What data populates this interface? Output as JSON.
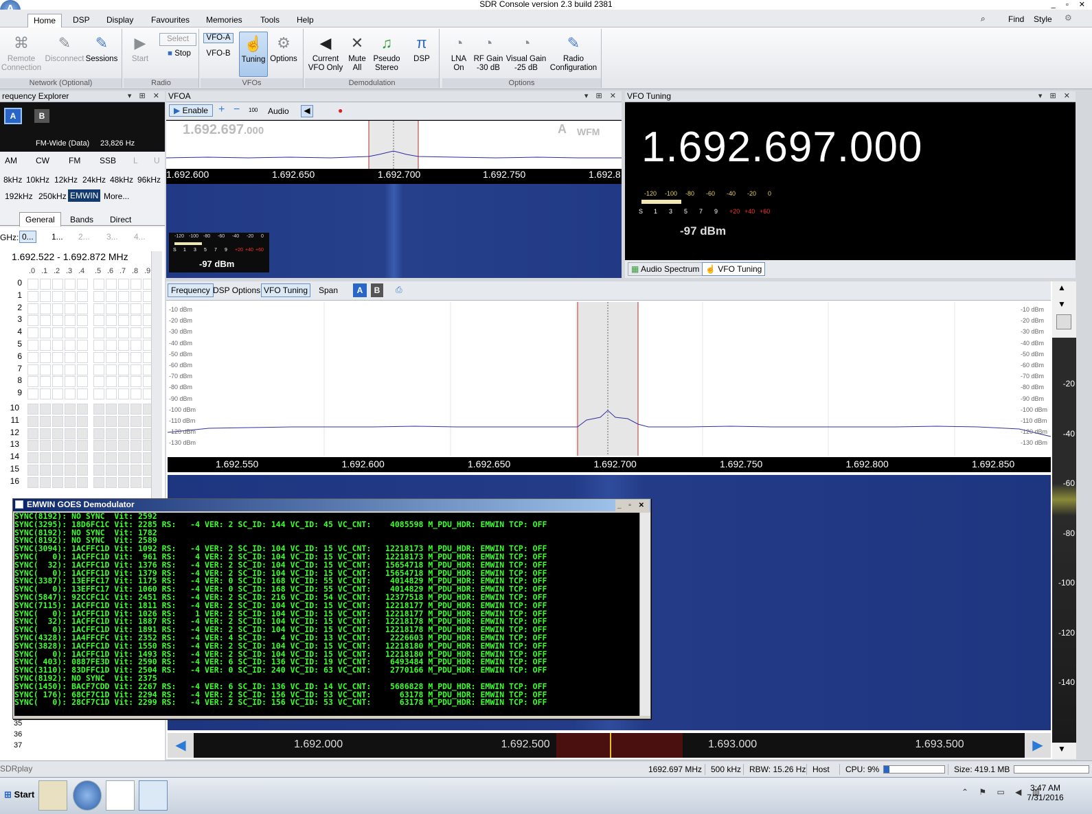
{
  "window": {
    "title": "SDR Console version 2.3 build 2381"
  },
  "ribbon_tabs": [
    "Home",
    "DSP",
    "Display",
    "Favourites",
    "Memories",
    "Tools",
    "Help"
  ],
  "top_right": {
    "find": "Find",
    "style": "Style"
  },
  "ribbon": {
    "network": {
      "remote": "Remote Connection",
      "disconnect": "Disconnect",
      "sessions": "Sessions",
      "label": "Network (Optional)"
    },
    "radio": {
      "start": "Start",
      "select": "Select",
      "stop": "Stop",
      "label": "Radio"
    },
    "vfos": {
      "vfoa": "VFO-A",
      "vfob": "VFO-B",
      "label": "VFOs"
    },
    "demod": {
      "tuning": "Tuning",
      "options": "Options",
      "current_vfo": "Current VFO Only",
      "mute_all": "Mute All",
      "pseudo_stereo": "Pseudo Stereo",
      "dsp": "DSP",
      "label": "Demodulation"
    },
    "options": {
      "lna": "LNA On",
      "rf_gain": "RF Gain -30 dB",
      "visual_gain": "Visual Gain -25 dB",
      "radio_config": "Radio Configuration",
      "label": "Options"
    }
  },
  "freq_explorer": {
    "title": "requency Explorer",
    "mode": "FM-Wide (Data)",
    "bandwidth": "23,826 Hz",
    "modes": [
      "AM",
      "CW",
      "FM",
      "SSB",
      "L",
      "U"
    ],
    "filters": [
      "8kHz",
      "10kHz",
      "12kHz",
      "24kHz",
      "48kHz",
      "96kHz",
      "192kHz",
      "250kHz",
      "EMWIN",
      "More..."
    ],
    "tabs": [
      "General",
      "Bands",
      "Direct"
    ],
    "ghz_label": "GHz:",
    "ghz_buttons": [
      "0...",
      "1...",
      "2...",
      "3...",
      "4..."
    ],
    "range": "1.692.522 - 1.692.872 MHz",
    "cols": [
      ".0",
      ".1",
      ".2",
      ".3",
      ".4",
      ".5",
      ".6",
      ".7",
      ".8",
      ".9"
    ],
    "rows": [
      "0",
      "1",
      "2",
      "3",
      "4",
      "5",
      "6",
      "7",
      "8",
      "9",
      "10",
      "11",
      "12",
      "13",
      "14",
      "15",
      "16"
    ],
    "rows_bottom": [
      "35",
      "36",
      "37"
    ]
  },
  "vfoa": {
    "title": "VFOA",
    "enable": "Enable",
    "audio": "Audio",
    "step": "100",
    "freq_main": "1.692.697",
    "freq_sub": ".000",
    "vfo_letter": "A",
    "mode": "WFM",
    "axis": [
      "1.692.600",
      "1.692.650",
      "1.692.700",
      "1.692.750",
      "1.692.8"
    ],
    "meter_ticks": [
      "-120",
      "-100",
      "-80",
      "-60",
      "-40",
      "-20",
      "0"
    ],
    "meter_s": [
      "S",
      "1",
      "3",
      "5",
      "7",
      "9",
      "+20",
      "+40",
      "+60"
    ],
    "dbm": "-97 dBm"
  },
  "vfo_tuning": {
    "title": "VFO Tuning",
    "freq": "1.692.697.000",
    "meter_ticks": [
      "-120",
      "-100",
      "-80",
      "-60",
      "-40",
      "-20",
      "0"
    ],
    "meter_s": [
      "S",
      "1",
      "3",
      "5",
      "7",
      "9",
      "+20",
      "+40",
      "+60"
    ],
    "dbm": "-97 dBm",
    "tabs": [
      "Audio Spectrum",
      "VFO Tuning"
    ]
  },
  "spectrum": {
    "toolbar": [
      "Frequency",
      "DSP Options",
      "VFO Tuning",
      "Span"
    ],
    "ab": [
      "A",
      "B"
    ],
    "dbm": [
      "-10 dBm",
      "-20 dBm",
      "-30 dBm",
      "-40 dBm",
      "-50 dBm",
      "-60 dBm",
      "-70 dBm",
      "-80 dBm",
      "-90 dBm",
      "-100 dBm",
      "-110 dBm",
      "-120 dBm",
      "-130 dBm"
    ],
    "axis": [
      "1.692.550",
      "1.692.600",
      "1.692.650",
      "1.692.700",
      "1.692.750",
      "1.692.800",
      "1.692.850"
    ],
    "wf_scale": [
      "-20",
      "-40",
      "-60",
      "-80",
      "-100",
      "-120",
      "-140"
    ],
    "bottom_axis": [
      "1.692.000",
      "1.692.500",
      "1.693.000",
      "1.693.500"
    ]
  },
  "emwin": {
    "title": "EMWIN GOES Demodulator",
    "lines": [
      "SYNC(8192): NO SYNC  Vit: 2592",
      "SYNC(3295): 18D6FC1C Vit: 2285 RS:   -4 VER: 2 SC_ID: 144 VC_ID: 45 VC_CNT:    4085598 M_PDU_HDR: EMWIN TCP: OFF",
      "SYNC(8192): NO SYNC  Vit: 1782",
      "SYNC(8192): NO SYNC  Vit: 2589",
      "SYNC(3094): 1ACFFC1D Vit: 1092 RS:   -4 VER: 2 SC_ID: 104 VC_ID: 15 VC_CNT:   12218173 M_PDU_HDR: EMWIN TCP: OFF",
      "SYNC(   0): 1ACFFC1D Vit:  961 RS:    4 VER: 2 SC_ID: 104 VC_ID: 15 VC_CNT:   12218173 M_PDU_HDR: EMWIN TCP: OFF",
      "SYNC(  32): 1ACFFC1D Vit: 1376 RS:   -4 VER: 2 SC_ID: 104 VC_ID: 15 VC_CNT:   15654718 M_PDU_HDR: EMWIN TCP: OFF",
      "SYNC(   0): 1ACFFC1D Vit: 1379 RS:   -4 VER: 2 SC_ID: 104 VC_ID: 15 VC_CNT:   15654718 M_PDU_HDR: EMWIN TCP: OFF",
      "SYNC(3387): 13EFFC17 Vit: 1175 RS:   -4 VER: 0 SC_ID: 168 VC_ID: 55 VC_CNT:    4014829 M_PDU_HDR: EMWIN TCP: OFF",
      "SYNC(   0): 13EFFC17 Vit: 1060 RS:   -4 VER: 0 SC_ID: 168 VC_ID: 55 VC_CNT:    4014829 M_PDU_HDR: EMWIN TCP: OFF",
      "SYNC(5847): 92CCFC1C Vit: 2451 RS:   -4 VER: 2 SC_ID: 216 VC_ID: 54 VC_CNT:   12377518 M_PDU_HDR: EMWIN TCP: OFF",
      "SYNC(7115): 1ACFFC1D Vit: 1811 RS:   -4 VER: 2 SC_ID: 104 VC_ID: 15 VC_CNT:   12218177 M_PDU_HDR: EMWIN TCP: OFF",
      "SYNC(   0): 1ACFFC1D Vit: 1026 RS:    1 VER: 2 SC_ID: 104 VC_ID: 15 VC_CNT:   12218177 M_PDU_HDR: EMWIN TCP: OFF",
      "SYNC(  32): 1ACFFC1D Vit: 1887 RS:   -4 VER: 2 SC_ID: 104 VC_ID: 15 VC_CNT:   12218178 M_PDU_HDR: EMWIN TCP: OFF",
      "SYNC(   0): 1ACFFC1D Vit: 1891 RS:   -4 VER: 2 SC_ID: 104 VC_ID: 15 VC_CNT:   12218178 M_PDU_HDR: EMWIN TCP: OFF",
      "SYNC(4328): 1A4FFCFC Vit: 2352 RS:   -4 VER: 4 SC_ID:   4 VC_ID: 13 VC_CNT:    2226603 M_PDU_HDR: EMWIN TCP: OFF",
      "SYNC(3828): 1ACFFC1D Vit: 1550 RS:   -4 VER: 2 SC_ID: 104 VC_ID: 15 VC_CNT:   12218180 M_PDU_HDR: EMWIN TCP: OFF",
      "SYNC(   0): 1ACFFC1D Vit: 1493 RS:   -4 VER: 2 SC_ID: 104 VC_ID: 15 VC_CNT:   12218180 M_PDU_HDR: EMWIN TCP: OFF",
      "SYNC( 403): 0887FE3D Vit: 2590 RS:   -4 VER: 6 SC_ID: 136 VC_ID: 19 VC_CNT:    6493484 M_PDU_HDR: EMWIN TCP: OFF",
      "SYNC(3110): 83DFFC1D Vit: 2504 RS:   -4 VER: 0 SC_ID: 240 VC_ID: 63 VC_CNT:    2770166 M_PDU_HDR: EMWIN TCP: OFF",
      "SYNC(8192): NO SYNC  Vit: 2375",
      "SYNC(1450): BACF7CDD Vit: 2267 RS:   -4 VER: 6 SC_ID: 136 VC_ID: 14 VC_CNT:    5686828 M_PDU_HDR: EMWIN TCP: OFF",
      "SYNC( 176): 68CF7C1D Vit: 2294 RS:   -4 VER: 2 SC_ID: 156 VC_ID: 53 VC_CNT:      63178 M_PDU_HDR: EMWIN TCP: OFF",
      "SYNC(   0): 28CF7C1D Vit: 2299 RS:   -4 VER: 2 SC_ID: 156 VC_ID: 53 VC_CNT:      63178 M_PDU_HDR: EMWIN TCP: OFF"
    ]
  },
  "status": {
    "radio": "SDRplay",
    "freq": "1692.697 MHz",
    "span": "500 kHz",
    "rbw": "RBW: 15.26 Hz",
    "host": "Host",
    "cpu": "CPU: 9%",
    "size": "Size: 419.1 MB"
  },
  "taskbar": {
    "start": "Start",
    "time": "3:47 AM",
    "date": "7/31/2016"
  }
}
